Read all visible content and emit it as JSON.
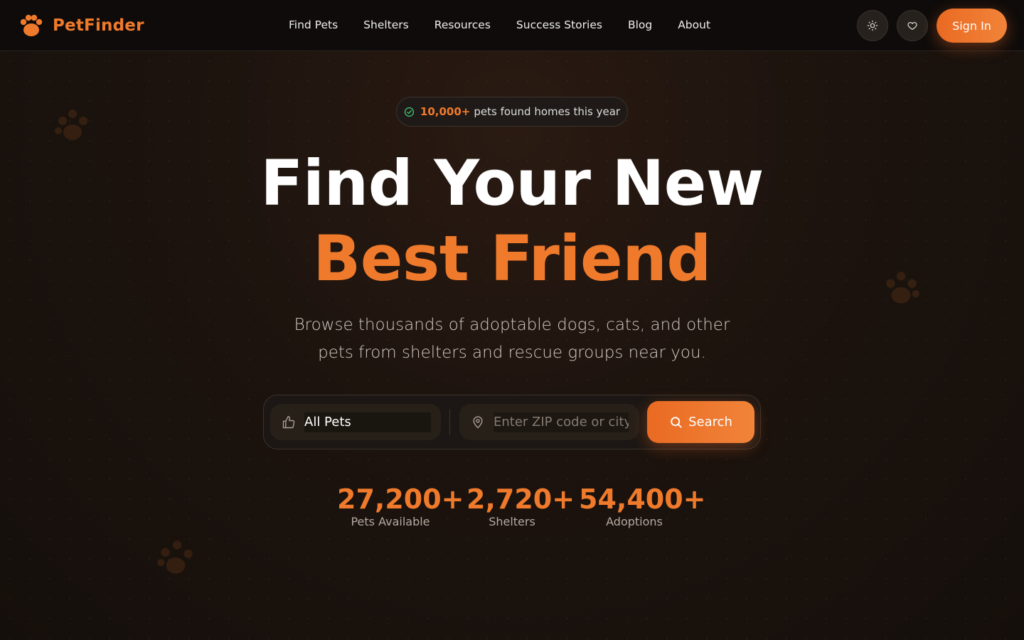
{
  "brand": {
    "name": "PetFinder",
    "accent": "#f07a2c"
  },
  "nav": {
    "items": [
      {
        "label": "Find Pets"
      },
      {
        "label": "Shelters"
      },
      {
        "label": "Resources"
      },
      {
        "label": "Success Stories"
      },
      {
        "label": "Blog"
      },
      {
        "label": "About"
      }
    ]
  },
  "header": {
    "theme_icon": "sun-icon",
    "favorites_icon": "heart-icon",
    "signin_label": "Sign In"
  },
  "hero": {
    "badge_highlight": "10,000+",
    "badge_text": "pets found homes this year",
    "title_line1": "Find Your New",
    "title_line2": "Best Friend",
    "subtitle": "Browse thousands of adoptable dogs, cats, and other pets from shelters and rescue groups near you."
  },
  "search": {
    "pet_type_value": "All Pets",
    "location_placeholder": "Enter ZIP code or city",
    "button_label": "Search"
  },
  "stats": [
    {
      "value": "27,200+",
      "label": "Pets Available"
    },
    {
      "value": "2,720+",
      "label": "Shelters"
    },
    {
      "value": "54,400+",
      "label": "Adoptions"
    }
  ]
}
